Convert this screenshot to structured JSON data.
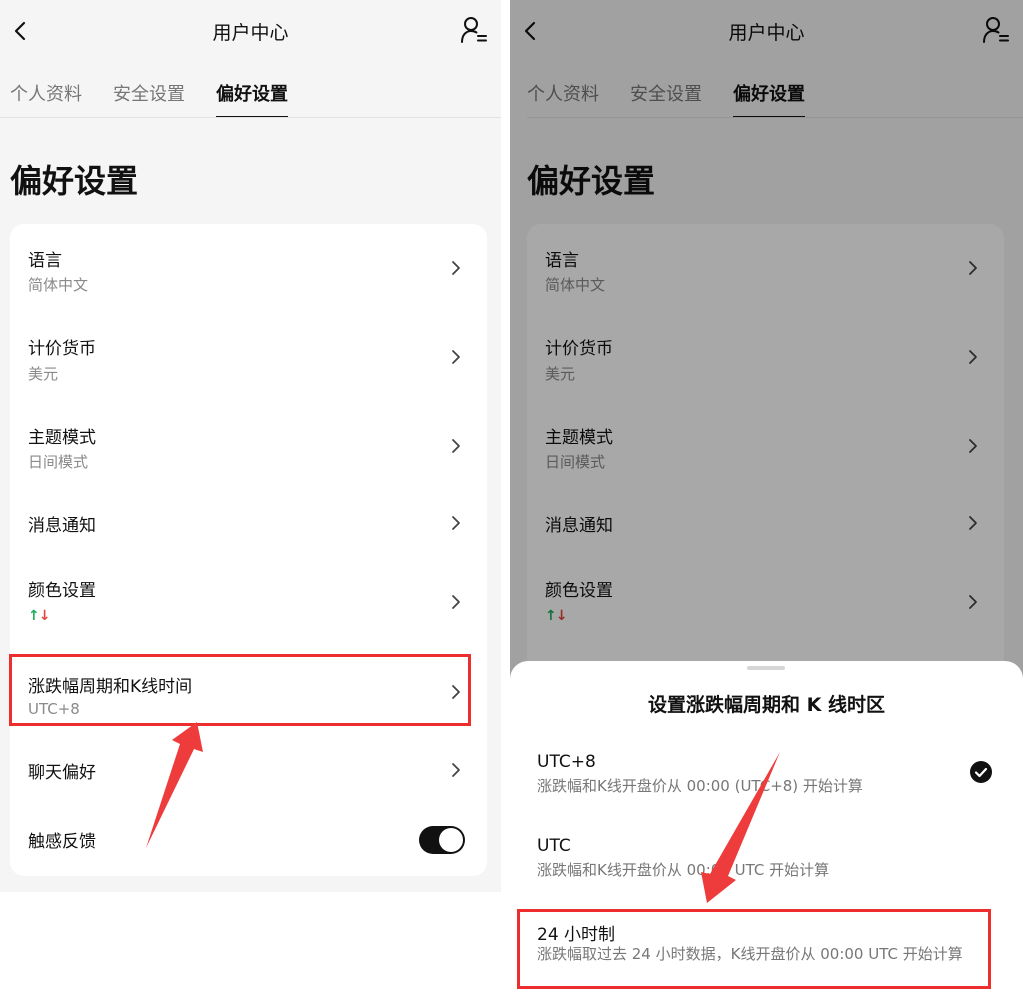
{
  "header": {
    "title": "用户中心"
  },
  "tabs": [
    {
      "label": "个人资料"
    },
    {
      "label": "安全设置"
    },
    {
      "label": "偏好设置"
    }
  ],
  "page_title": "偏好设置",
  "settings": [
    {
      "label": "语言",
      "value": "简体中文"
    },
    {
      "label": "计价货币",
      "value": "美元"
    },
    {
      "label": "主题模式",
      "value": "日间模式"
    },
    {
      "label": "消息通知"
    },
    {
      "label": "颜色设置",
      "value_icons": [
        "arrow-up-green-icon",
        "arrow-down-red-icon"
      ]
    },
    {
      "label": "涨跌幅周期和K线时间",
      "value": "UTC+8"
    },
    {
      "label": "聊天偏好"
    },
    {
      "label": "触感反馈",
      "toggle_on": true
    }
  ],
  "sheet": {
    "title": "设置涨跌幅周期和 K 线时区",
    "options": [
      {
        "label": "UTC+8",
        "desc": "涨跌幅和K线开盘价从 00:00 (UTC+8) 开始计算",
        "selected": true
      },
      {
        "label": "UTC",
        "desc": "涨跌幅和K线开盘价从 00:00 UTC 开始计算",
        "selected": false
      },
      {
        "label": "24 小时制",
        "desc": "涨跌幅取过去 24 小时数据，K线开盘价从 00:00 UTC 开始计算",
        "selected": false
      }
    ]
  },
  "colors": {
    "accent": "#111111",
    "highlight": "#ee2e2e",
    "up": "#1fae5a",
    "down": "#e2463c"
  }
}
